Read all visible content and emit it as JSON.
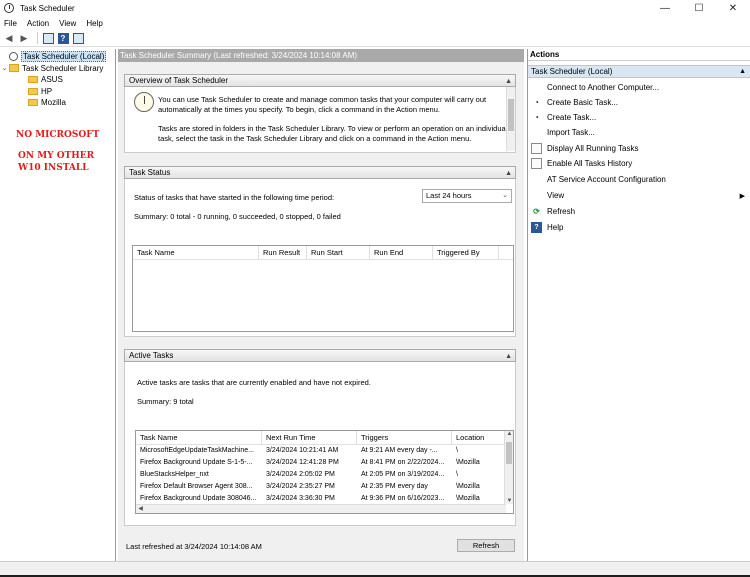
{
  "window": {
    "title": "Task Scheduler",
    "controls": [
      "—",
      "☐",
      "✕"
    ]
  },
  "menu": [
    "File",
    "Action",
    "View",
    "Help"
  ],
  "tree": {
    "root": "Task Scheduler (Local)",
    "library": "Task Scheduler Library",
    "folders": [
      "ASUS",
      "HP",
      "Mozilla"
    ]
  },
  "annotation": {
    "line1": "NO MICROSOFT",
    "line2": "ON MY OTHER",
    "line3": "W10 INSTALL"
  },
  "center": {
    "header": "Task Scheduler Summary (Last refreshed: 3/24/2024 10:14:08 AM)",
    "overview": {
      "title": "Overview of Task Scheduler",
      "p1": "You can use Task Scheduler to create and manage common tasks that your computer will carry out automatically at the times you specify. To begin, click a command in the Action menu.",
      "p2": "Tasks are stored in folders in the Task Scheduler Library. To view or perform an operation on an individual task, select the task in the Task Scheduler Library and click on a command in the Action menu."
    },
    "status": {
      "title": "Task Status",
      "period_label": "Status of tasks that have started in the following time period:",
      "period_value": "Last 24 hours",
      "summary": "Summary: 0 total - 0 running, 0 succeeded, 0 stopped, 0 failed",
      "columns": [
        "Task Name",
        "Run Result",
        "Run Start",
        "Run End",
        "Triggered By"
      ]
    },
    "active": {
      "title": "Active Tasks",
      "description": "Active tasks are tasks that are currently enabled and have not expired.",
      "summary": "Summary: 9 total",
      "columns": [
        "Task Name",
        "Next Run Time",
        "Triggers",
        "Location"
      ],
      "rows": [
        [
          "MicrosoftEdgeUpdateTaskMachine...",
          "3/24/2024 10:21:41 AM",
          "At 9:21 AM every day -...",
          "\\"
        ],
        [
          "Firefox Background Update S-1-5-...",
          "3/24/2024 12:41:28 PM",
          "At 8:41 PM on 2/22/2024...",
          "\\Mozilla"
        ],
        [
          "BlueStacksHelper_nxt",
          "3/24/2024 2:05:02 PM",
          "At 2:05 PM on 3/19/2024...",
          "\\"
        ],
        [
          "Firefox Default Browser Agent 308...",
          "3/24/2024 2:35:27 PM",
          "At 2:35 PM every day",
          "\\Mozilla"
        ],
        [
          "Firefox Background Update 308046...",
          "3/24/2024 3:36:30 PM",
          "At 9:36 PM on 6/16/2023...",
          "\\Mozilla"
        ]
      ]
    },
    "footer": {
      "last_refreshed": "Last refreshed at 3/24/2024 10:14:08 AM",
      "refresh_button": "Refresh"
    }
  },
  "actions": {
    "title": "Actions",
    "group": "Task Scheduler (Local)",
    "items": [
      "Connect to Another Computer...",
      "Create Basic Task...",
      "Create Task...",
      "Import Task...",
      "Display All Running Tasks",
      "Enable All Tasks History",
      "AT Service Account Configuration",
      "View",
      "Refresh",
      "Help"
    ]
  },
  "colors": {
    "annotation": "#e01b1b",
    "header_bar": "#a9a9a9",
    "action_group": "#dbe6f3"
  }
}
